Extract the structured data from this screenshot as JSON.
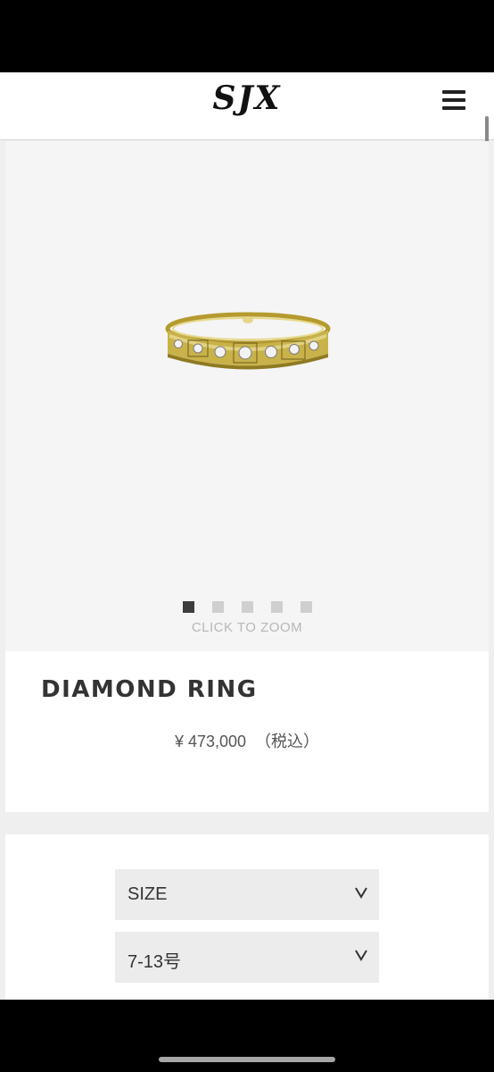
{
  "header": {
    "logo_text": "SJX",
    "menu_icon": "hamburger-menu-icon"
  },
  "gallery": {
    "image_icon": "diamond-ring-image",
    "slide_count": 5,
    "active_slide": 1,
    "zoom_label": "CLICK TO ZOOM"
  },
  "product": {
    "name": "DIAMOND RING",
    "price": "¥ 473,000",
    "tax_note": "（税込）"
  },
  "options": {
    "size_select": {
      "label": "SIZE",
      "icon": "chevron-down-icon"
    },
    "range_select": {
      "label": "7-13号",
      "icon": "chevron-down-icon"
    }
  },
  "colors": {
    "gallery_bg": "#f5f5f5",
    "page_bg": "#efefef",
    "dot_active": "#3d3d3d",
    "dot_inactive": "#cfcfcf",
    "gold": "#c9b24a"
  }
}
